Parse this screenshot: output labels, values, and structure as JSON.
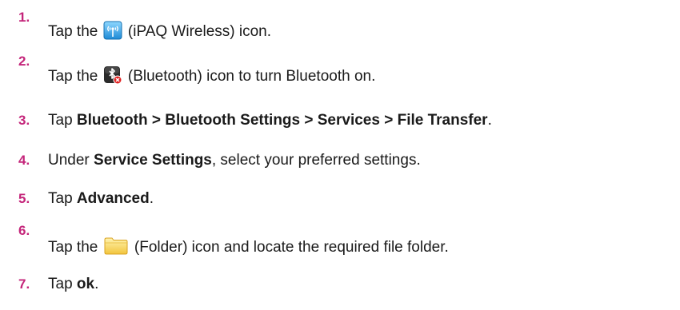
{
  "steps": [
    {
      "number": "1.",
      "before": "Tap the",
      "icon": "ipaq-wireless-icon",
      "after": "(iPAQ Wireless) icon."
    },
    {
      "number": "2.",
      "before": "Tap the",
      "icon": "bluetooth-icon",
      "after": "(Bluetooth) icon to turn Bluetooth on."
    },
    {
      "number": "3.",
      "before": "Tap",
      "bold": "Bluetooth > Bluetooth Settings > Services > File Transfer",
      "after": "."
    },
    {
      "number": "4.",
      "before": "Under",
      "bold": "Service Settings",
      "after": ", select your preferred settings."
    },
    {
      "number": "5.",
      "before": "Tap",
      "bold": "Advanced",
      "after": "."
    },
    {
      "number": "6.",
      "before": "Tap the",
      "icon": "folder-icon",
      "after": "(Folder) icon and locate the required file folder."
    },
    {
      "number": "7.",
      "before": "Tap",
      "bold": "ok",
      "after": "."
    }
  ],
  "colors": {
    "step_number": "#c4257a",
    "body_text": "#1a1a1a"
  }
}
